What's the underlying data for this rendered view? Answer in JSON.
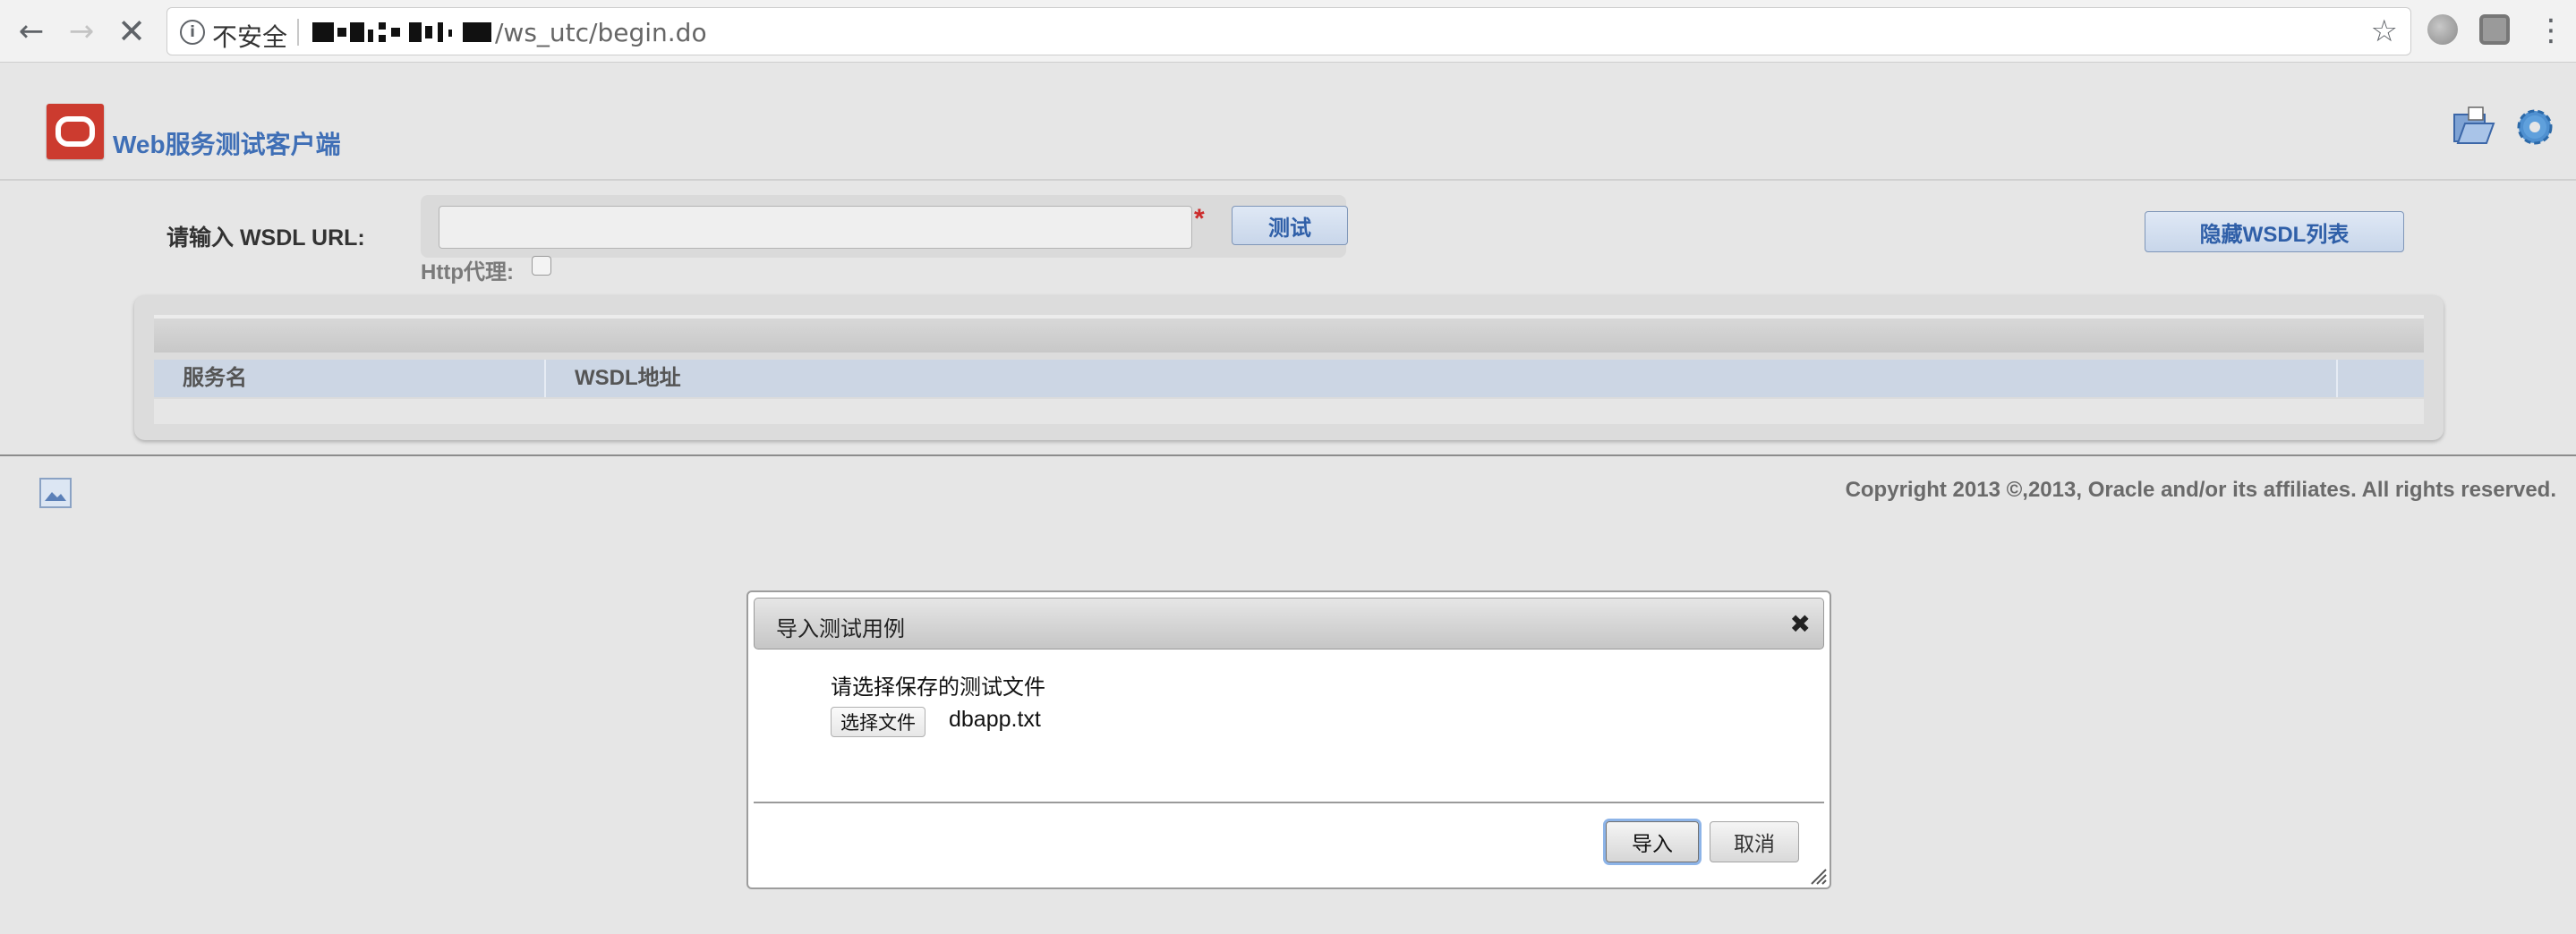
{
  "browser": {
    "back_icon": "←",
    "forward_icon": "→",
    "stop_icon": "✕",
    "info_icon": "i",
    "security_label": "不安全",
    "url_path": "/ws_utc/begin.do",
    "bookmark_icon": "☆",
    "menu_icon": "⋮"
  },
  "app": {
    "title": "Web服务测试客户端"
  },
  "form": {
    "url_label": "请输入 WSDL URL:",
    "url_value": "",
    "required_mark": "*",
    "test_button": "测试",
    "proxy_label": "Http代理:",
    "hide_wsdl_button": "隐藏WSDL列表"
  },
  "table": {
    "columns": [
      "服务名",
      "WSDL地址"
    ]
  },
  "footer": {
    "copyright": "Copyright 2013 ©,2013, Oracle and/or its affiliates. All rights reserved."
  },
  "dialog": {
    "title": "导入测试用例",
    "close_icon": "✖",
    "prompt": "请选择保存的测试文件",
    "choose_file_button": "选择文件",
    "file_name": "dbapp.txt",
    "import_button": "导入",
    "cancel_button": "取消"
  }
}
